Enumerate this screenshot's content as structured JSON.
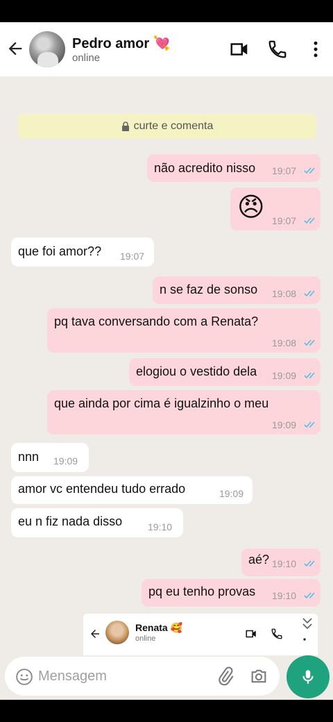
{
  "header": {
    "contact_name": "Pedro amor 💘",
    "contact_status": "online"
  },
  "notice": {
    "text": "curte e comenta",
    "icon": "lock-icon"
  },
  "messages": [
    {
      "dir": "out",
      "text": "não acredito nisso",
      "time": "19:07",
      "read": true
    },
    {
      "dir": "out",
      "text": "😠",
      "time": "19:07",
      "read": true
    },
    {
      "dir": "in",
      "text": "que foi amor??",
      "time": "19:07"
    },
    {
      "dir": "out",
      "text": "n se faz de sonso",
      "time": "19:08",
      "read": true
    },
    {
      "dir": "out",
      "text": "pq tava conversando com a Renata?",
      "time": "19:08",
      "read": true
    },
    {
      "dir": "out",
      "text": "elogiou o vestido dela",
      "time": "19:09",
      "read": true
    },
    {
      "dir": "out",
      "text": "que ainda por cima é igualzinho o meu",
      "time": "19:09",
      "read": true
    },
    {
      "dir": "in",
      "text": "nnn",
      "time": "19:09"
    },
    {
      "dir": "in",
      "text": "amor vc entendeu tudo errado",
      "time": "19:09"
    },
    {
      "dir": "in",
      "text": "eu n fiz nada disso",
      "time": "19:10"
    },
    {
      "dir": "out",
      "text": "aé?",
      "time": "19:10",
      "read": true
    },
    {
      "dir": "out",
      "text": "pq eu tenho provas",
      "time": "19:10",
      "read": true
    }
  ],
  "overlay": {
    "contact_name": "Renata 🥰",
    "contact_status": "online"
  },
  "composer": {
    "placeholder": "Mensagem"
  },
  "colors": {
    "outgoing_bubble": "#fcd6db",
    "incoming_bubble": "#ffffff",
    "chat_background": "#efebe6",
    "read_ticks": "#53bdeb",
    "accent": "#1fa37f"
  }
}
